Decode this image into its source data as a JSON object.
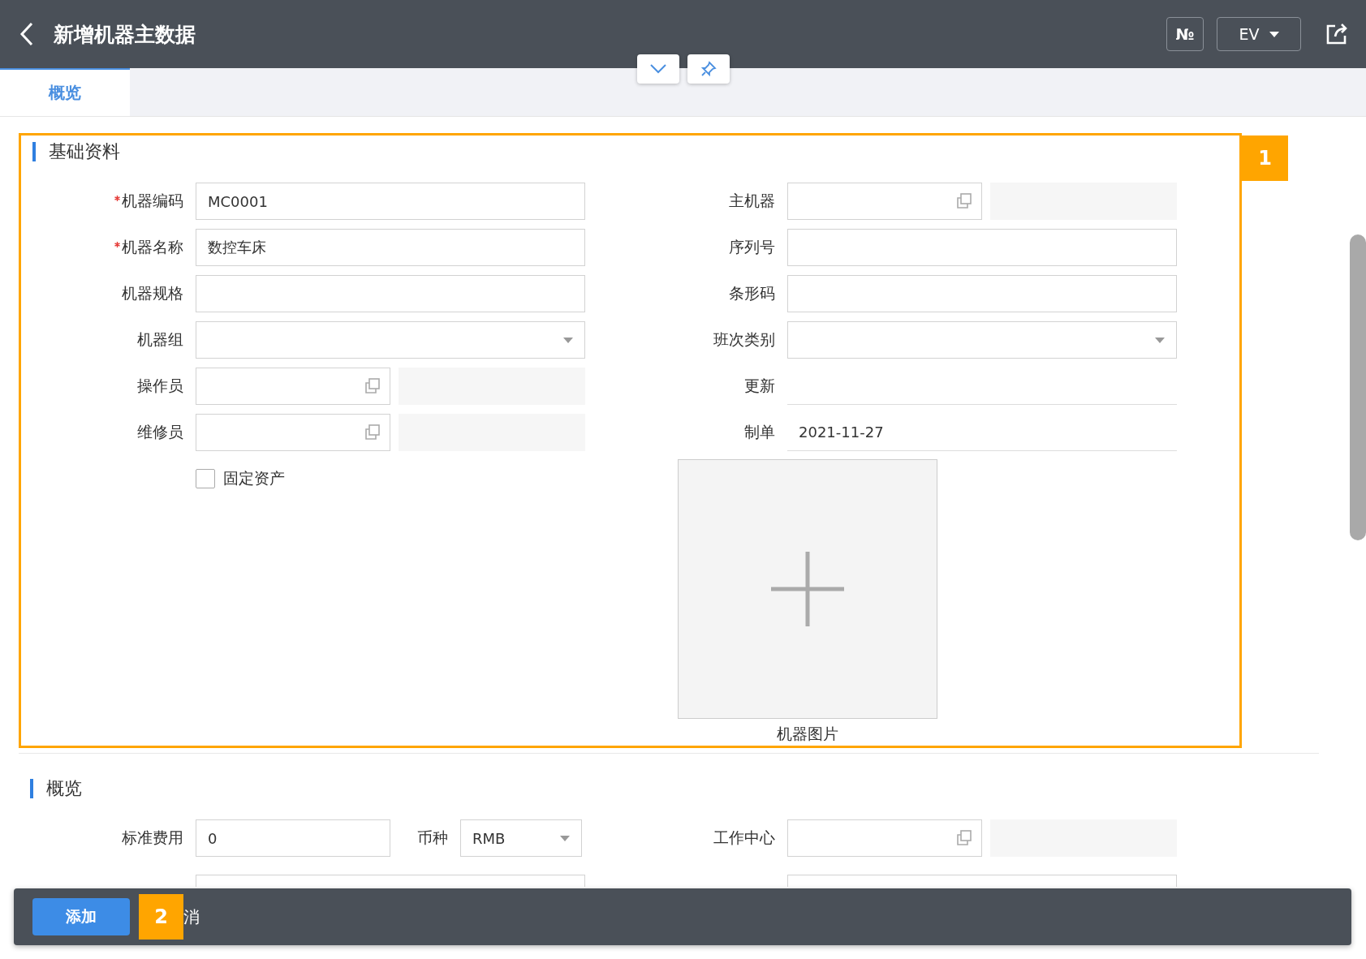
{
  "header": {
    "title": "新增机器主数据",
    "no_button": "№",
    "language": "EV"
  },
  "tabs": [
    {
      "label": "概览",
      "selected": true
    }
  ],
  "sections": [
    {
      "title": "基础资料",
      "callout": "1",
      "left": [
        {
          "kind": "text",
          "label": "机器编码",
          "required": true,
          "value": "MC0001"
        },
        {
          "kind": "text",
          "label": "机器名称",
          "required": true,
          "value": "数控车床"
        },
        {
          "kind": "text",
          "label": "机器规格",
          "required": false
        },
        {
          "kind": "select",
          "label": "机器组",
          "required": false
        },
        {
          "kind": "lookup",
          "label": "操作员",
          "required": false
        },
        {
          "kind": "lookup",
          "label": "维修员",
          "required": false
        },
        {
          "kind": "checkbox",
          "label": "固定资产",
          "checked": false
        }
      ],
      "right": [
        {
          "kind": "lookup",
          "label": "主机器",
          "required": false
        },
        {
          "kind": "text",
          "label": "序列号",
          "required": false
        },
        {
          "kind": "text",
          "label": "条形码",
          "required": false
        },
        {
          "kind": "select",
          "label": "班次类别",
          "required": false
        },
        {
          "kind": "readonly",
          "label": "更新",
          "required": false
        },
        {
          "kind": "readonly",
          "label": "制单",
          "required": false,
          "value": "2021-11-27"
        },
        {
          "kind": "image",
          "label": "机器图片"
        }
      ]
    },
    {
      "title": "概览",
      "left": [
        {
          "kind": "money",
          "label": "标准费用",
          "required": false,
          "value": "0",
          "currency_label": "币种",
          "currency": "RMB"
        }
      ],
      "right": [
        {
          "kind": "lookup",
          "label": "工作中心",
          "required": false
        }
      ]
    }
  ],
  "toolbar": {
    "primary": "添加",
    "cancel": "消",
    "callout": "2"
  }
}
